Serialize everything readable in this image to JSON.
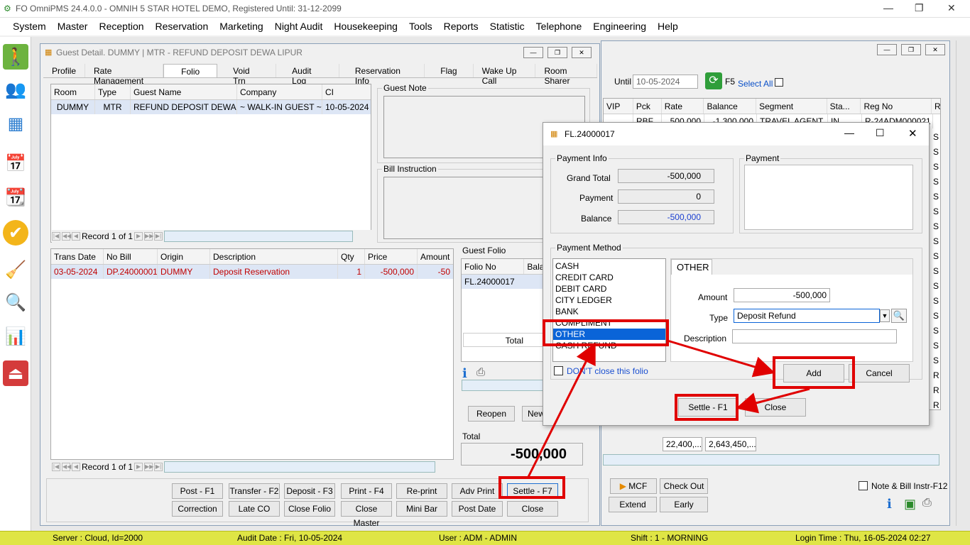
{
  "app": {
    "title": "FO OmniPMS 24.4.0.0 - OMNIH 5 STAR HOTEL DEMO, Registered Until: 31-12-2099"
  },
  "menu": [
    "System",
    "Master",
    "Reception",
    "Reservation",
    "Marketing",
    "Night Audit",
    "Housekeeping",
    "Tools",
    "Reports",
    "Statistic",
    "Telephone",
    "Engineering",
    "Help"
  ],
  "sidebar": [
    "walk-in-icon",
    "guests-icon",
    "floor-plan-icon",
    "calendar-icon",
    "year-calendar-icon",
    "checklist-icon",
    "housekeeping-icon",
    "search-analytics-icon",
    "statistics-icon",
    "exit-icon"
  ],
  "guest": {
    "title": "Guest Detail. DUMMY | MTR - REFUND DEPOSIT DEWA LIPUR",
    "tabs": [
      "Profile",
      "Rate Management",
      "Folio",
      "Void Trn",
      "Audit Log",
      "Reservation Info",
      "Flag",
      "Wake Up Call",
      "Room Sharer"
    ],
    "room_headers": [
      "Room",
      "Type",
      "Guest Name",
      "Company",
      "CI"
    ],
    "room_row": [
      "DUMMY",
      "MTR",
      "REFUND DEPOSIT DEWA LI...",
      "~ WALK-IN GUEST ~",
      "10-05-2024"
    ],
    "guest_note": "Guest Note",
    "bill_instruction": "Bill Instruction",
    "record": "Record 1 of 1",
    "trans_headers": [
      "Trans Date",
      "No Bill",
      "Origin",
      "Description",
      "Qty",
      "Price",
      "Amount"
    ],
    "trans_row": [
      "03-05-2024",
      "DP.24000001",
      "DUMMY",
      "Deposit Reservation",
      "1",
      "-500,000",
      "-50"
    ],
    "guest_folio": "Guest Folio",
    "folio_headers": [
      "Folio No",
      "Bala"
    ],
    "folio_row": "FL.24000017",
    "total_label": "Total",
    "reopen": "Reopen",
    "new": "New",
    "total_title": "Total",
    "total_value": "-500,000",
    "buttons_row1": [
      "Post - F1",
      "Transfer - F2",
      "Deposit - F3",
      "Print - F4",
      "Re-print",
      "Adv Print",
      "Settle - F7"
    ],
    "buttons_row2": [
      "Correction",
      "Late CO",
      "Close Folio",
      "Close Master",
      "Mini Bar",
      "Post Date",
      "Close"
    ]
  },
  "back": {
    "until_label": "Until",
    "until_value": "10-05-2024",
    "f5": "F5",
    "select_all": "Select All",
    "headers": [
      "VIP",
      "Pck",
      "Rate",
      "Balance",
      "Segment",
      "Sta...",
      "Reg No",
      "R"
    ],
    "row": [
      "",
      "RBF",
      "500,000",
      "-1,300,000",
      "TRAVEL AGENT",
      "IN",
      "R-24ADM000021"
    ],
    "right_col": [
      "S",
      "S",
      "S",
      "S",
      "S",
      "S",
      "S",
      "S",
      "S",
      "S",
      "S",
      "S",
      "S",
      "S",
      "S",
      "S",
      "R",
      "R",
      "R"
    ],
    "totals": [
      "22,400,...",
      "2,643,450,..."
    ],
    "mcf": "MCF",
    "check_out": "Check Out",
    "extend": "Extend",
    "early": "Early",
    "note_bill": "Note & Bill Instr-F12"
  },
  "dialog": {
    "title": "FL.24000017",
    "payment_info": "Payment Info",
    "payment": "Payment",
    "grand_total_label": "Grand Total",
    "grand_total": "-500,000",
    "payment_label": "Payment",
    "payment_value": "0",
    "balance_label": "Balance",
    "balance": "-500,000",
    "payment_method": "Payment Method",
    "methods": [
      "CASH",
      "CREDIT CARD",
      "DEBIT CARD",
      "CITY LEDGER",
      "BANK",
      "COMPLIMENT",
      "OTHER",
      "CASH REFUND"
    ],
    "selected": "OTHER",
    "other_tab": "OTHER",
    "amount_label": "Amount",
    "amount": "-500,000",
    "type_label": "Type",
    "type": "Deposit Refund",
    "description_label": "Description",
    "description": "",
    "dont_close": "DON'T close this folio",
    "add": "Add",
    "cancel": "Cancel",
    "settle": "Settle - F1",
    "close": "Close"
  },
  "status": {
    "server": "Server : Cloud, Id=2000",
    "audit": "Audit Date : Fri, 10-05-2024",
    "user": "User : ADM - ADMIN",
    "shift": "Shift : 1 - MORNING",
    "login": "Login Time : Thu, 16-05-2024 02:27"
  },
  "colors": {
    "highlight": "#e00000",
    "select": "#0a64d8",
    "status_bg": "#dfe545"
  }
}
